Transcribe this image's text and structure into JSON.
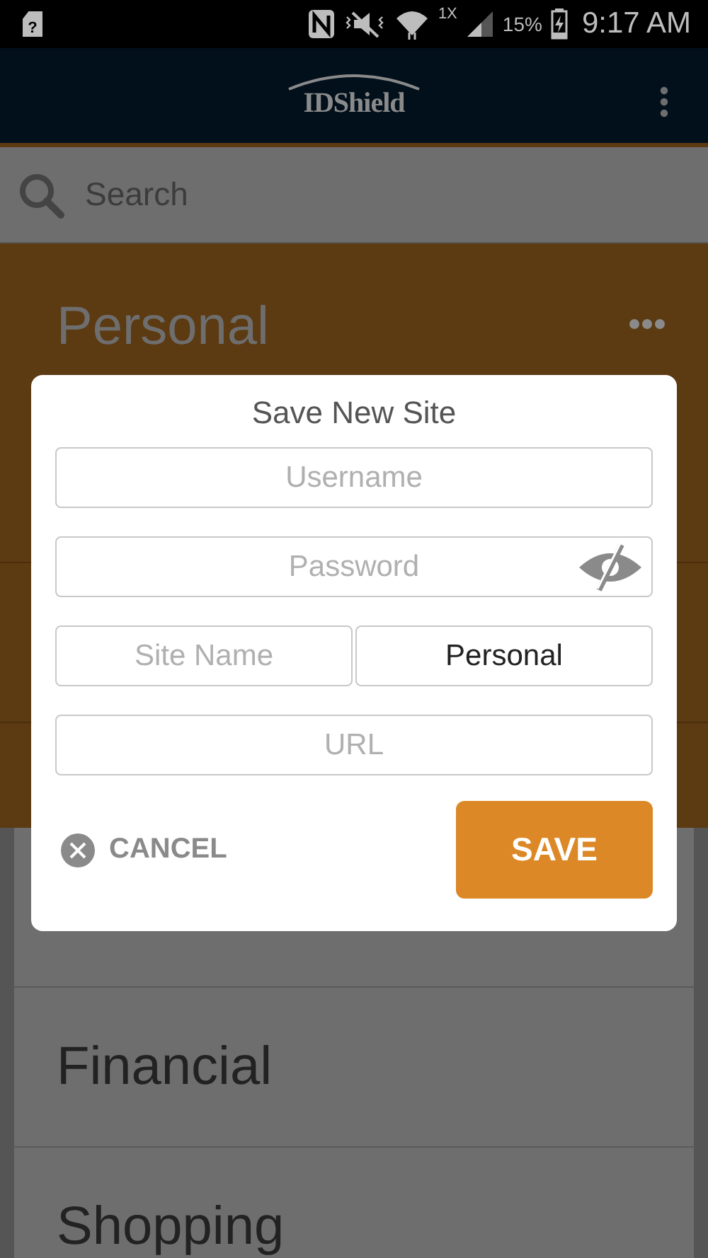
{
  "status_bar": {
    "sim_label": "?",
    "network": "1X",
    "battery": "15%",
    "time": "9:17 AM"
  },
  "app_bar": {
    "logo": "IDShield"
  },
  "search": {
    "placeholder": "Search"
  },
  "categories": [
    {
      "kind": "header",
      "name": "Personal",
      "expanded": true
    },
    {
      "kind": "covered"
    },
    {
      "kind": "row",
      "name": "Financial"
    },
    {
      "kind": "row",
      "name": "Shopping"
    }
  ],
  "dialog": {
    "title": "Save New Site",
    "fields": [
      {
        "kind": "text",
        "placeholder": "Username"
      },
      {
        "kind": "password",
        "placeholder": "Password",
        "revealed": false
      },
      {
        "kind": "pair",
        "placeholder": "Site Name",
        "value": "Personal"
      },
      {
        "kind": "text",
        "placeholder": "URL"
      }
    ],
    "cancel": "CANCEL",
    "save": "SAVE"
  }
}
